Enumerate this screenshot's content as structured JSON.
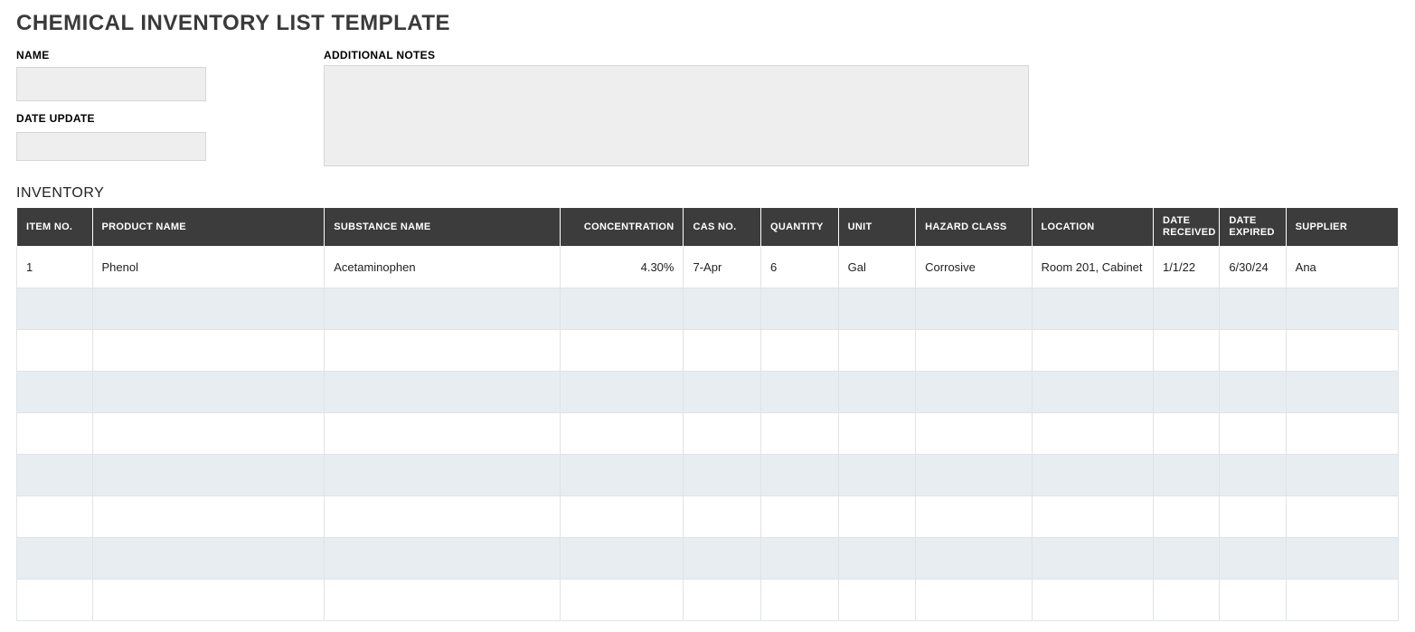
{
  "title": "CHEMICAL INVENTORY LIST TEMPLATE",
  "labels": {
    "name": "NAME",
    "date_update": "DATE UPDATE",
    "additional_notes": "ADDITIONAL NOTES",
    "inventory": "INVENTORY"
  },
  "fields": {
    "name": "",
    "date_update": "",
    "additional_notes": ""
  },
  "columns": {
    "item_no": "ITEM NO.",
    "product_name": "PRODUCT NAME",
    "substance_name": "SUBSTANCE NAME",
    "concentration": "CONCENTRATION",
    "cas_no": "CAS NO.",
    "quantity": "QUANTITY",
    "unit": "UNIT",
    "hazard_class": "HAZARD CLASS",
    "location": "LOCATION",
    "date_received": "DATE RECEIVED",
    "date_expired": "DATE EXPIRED",
    "supplier": "SUPPLIER"
  },
  "rows": [
    {
      "item_no": "1",
      "product_name": "Phenol",
      "substance_name": "Acetaminophen",
      "concentration": "4.30%",
      "cas_no": "7-Apr",
      "quantity": "6",
      "unit": "Gal",
      "hazard_class": "Corrosive",
      "location": "Room 201, Cabinet",
      "date_received": "1/1/22",
      "date_expired": "6/30/24",
      "supplier": "Ana"
    },
    {},
    {},
    {},
    {},
    {},
    {},
    {},
    {}
  ]
}
